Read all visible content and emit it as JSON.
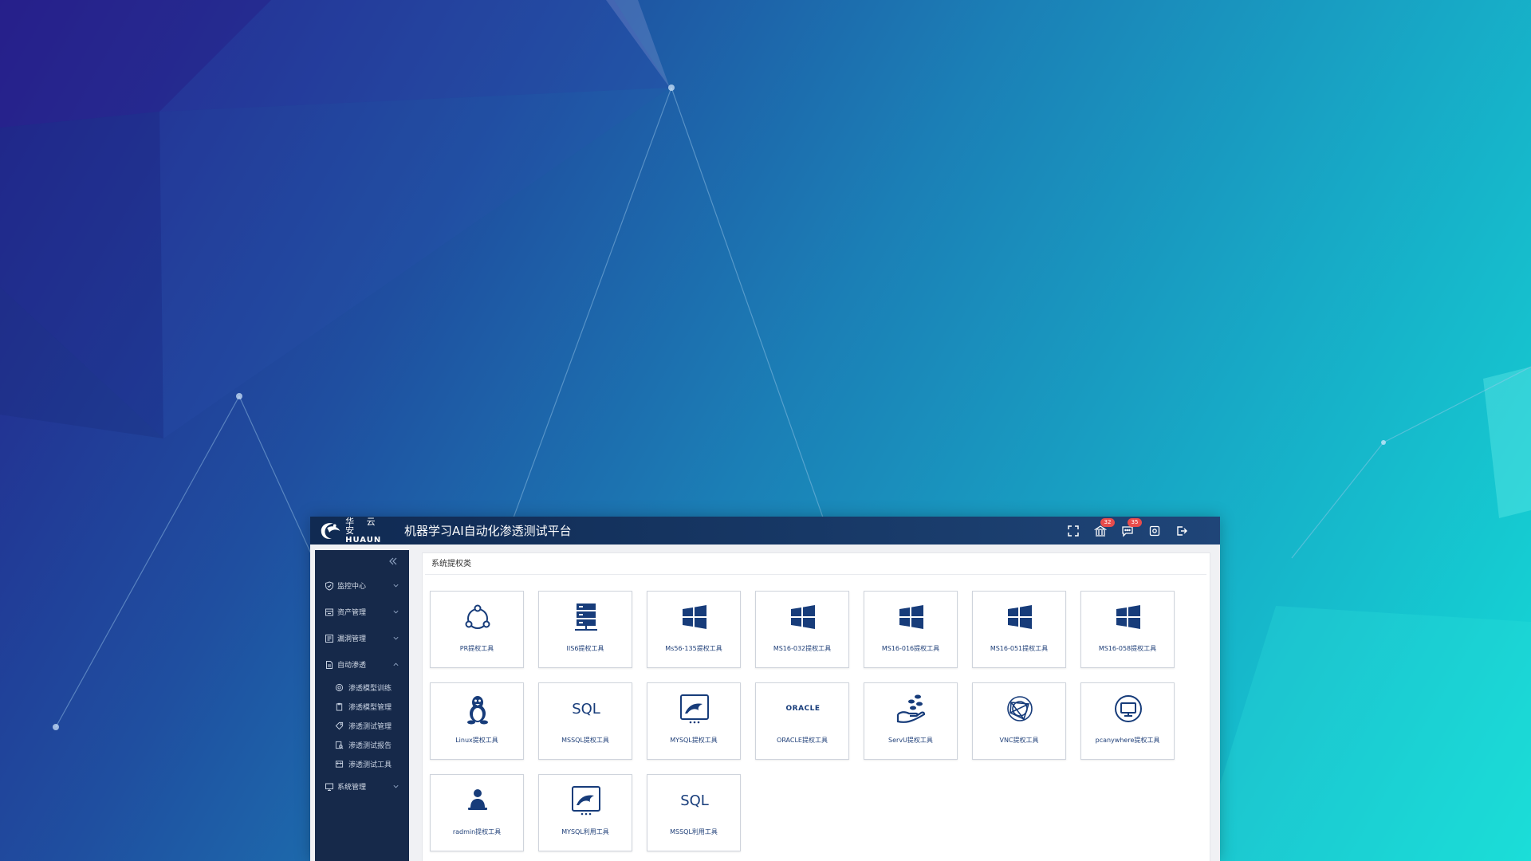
{
  "header": {
    "logo_cn": "华 云 安",
    "logo_en": "HUAUN",
    "title": "机器学习AI自动化渗透测试平台",
    "badge_alerts": "32",
    "badge_messages": "35"
  },
  "sidebar": {
    "items": [
      {
        "label": "监控中心"
      },
      {
        "label": "资产管理"
      },
      {
        "label": "漏洞管理"
      },
      {
        "label": "自动渗透"
      },
      {
        "label": "系统管理"
      }
    ],
    "subitems": [
      {
        "label": "渗透模型训练"
      },
      {
        "label": "渗透模型管理"
      },
      {
        "label": "渗透测试管理"
      },
      {
        "label": "渗透测试报告"
      },
      {
        "label": "渗透测试工具"
      }
    ]
  },
  "panel": {
    "title": "系统提权类"
  },
  "tools": [
    {
      "label": "PR提权工具",
      "icon": "share-nodes-icon"
    },
    {
      "label": "IIS6提权工具",
      "icon": "server-icon"
    },
    {
      "label": "Ms56-135提权工具",
      "icon": "windows-icon"
    },
    {
      "label": "MS16-032提权工具",
      "icon": "windows-icon"
    },
    {
      "label": "MS16-016提权工具",
      "icon": "windows-icon"
    },
    {
      "label": "MS16-051提权工具",
      "icon": "windows-icon"
    },
    {
      "label": "MS16-058提权工具",
      "icon": "windows-icon"
    },
    {
      "label": "Linux提权工具",
      "icon": "linux-icon"
    },
    {
      "label": "MSSQL提权工具",
      "icon": "sql-icon",
      "icon_text": "SQL"
    },
    {
      "label": "MYSQL提权工具",
      "icon": "mysql-dolphin-icon"
    },
    {
      "label": "ORACLE提权工具",
      "icon": "oracle-icon",
      "icon_text": "ORACLE"
    },
    {
      "label": "ServU提权工具",
      "icon": "hand-coins-icon"
    },
    {
      "label": "VNC提权工具",
      "icon": "vnc-globe-icon"
    },
    {
      "label": "pcanywhere提权工具",
      "icon": "monitor-icon"
    },
    {
      "label": "radmin提权工具",
      "icon": "user-laptop-icon"
    },
    {
      "label": "MYSQL利用工具",
      "icon": "mysql-dolphin-icon"
    },
    {
      "label": "MSSQL利用工具",
      "icon": "sql-icon",
      "icon_text": "SQL"
    }
  ],
  "colors": {
    "topbar": "#173866",
    "sidebar": "#16294a",
    "icon_blue": "#173c7a",
    "badge": "#e74c4c"
  }
}
